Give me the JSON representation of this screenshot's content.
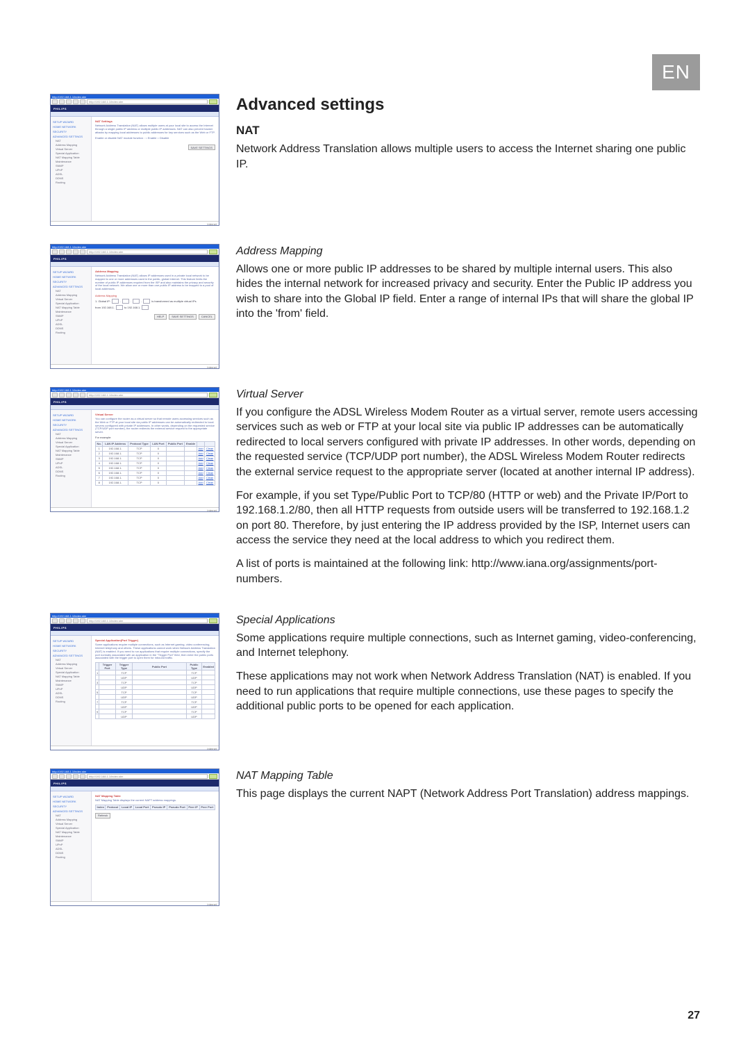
{
  "lang_badge": "EN",
  "page_number": "27",
  "heading_main": "Advanced settings",
  "mini_common": {
    "brand": "PHILIPS",
    "url": "http://192.168.1.1/index.stm",
    "footer": "Internet",
    "side_groups": [
      "SETUP WIZARD",
      "HOME NETWORK",
      "SECURITY",
      "ADVANCED SETTINGS"
    ],
    "side_items": [
      "NAT",
      "Address Mapping",
      "Virtual Server",
      "Special Application",
      "NAT Mapping Table",
      "Maintenance",
      "SNMP",
      "UPnP",
      "ADSL",
      "DDNS",
      "Routing"
    ]
  },
  "s1": {
    "h2": "NAT",
    "body": "Network Address Translation allows multiple users to access the Internet sharing one public IP.",
    "mini": {
      "title": "NAT Settings",
      "desc": "Network Address Translation (NAT) allows multiple users at your local site to access the Internet through a single public IP address or multiple public IP addresses. NAT can also prevent hacker attacks by mapping local addresses to public addresses for key services such as the Web or FTP.",
      "toggle": "Enable or disable NAT module function :   ○ Enable   ○ Disable",
      "btn_save": "SAVE SETTINGS"
    }
  },
  "s2": {
    "h3": "Address Mapping",
    "body": "Allows one or more public IP addresses to be shared by multiple internal users. This also hides the internal network for increased privacy and security. Enter the Public IP address you wish to share into the Global IP field. Enter a range of internal IPs that will share the global IP into the 'from' field.",
    "mini": {
      "title": "Address Mapping",
      "desc": "Network Address Translation (NAT) allows IP addresses used in a private local network to be mapped to one or more addresses used in the public, global Internet. This feature limits the number of public IP addresses required from the ISP and also maintains the privacy and security of the local network. We allow one or more than one public IP address to be mapped to a pool of local addresses.",
      "sect": "Address Mapping",
      "row1_pre": "1. Global IP:",
      "row1_post": "is transformed as multiple virtual IPs",
      "row2_pre": "from 192.168.1.",
      "row2_mid": "to 192.168.1.",
      "btn_help": "HELP",
      "btn_save": "SAVE SETTINGS",
      "btn_cancel": "CANCEL"
    }
  },
  "s3": {
    "h3": "Virtual Server",
    "p1": "If you configure the ADSL Wireless Modem Router as a virtual server, remote users accessing services such as web or FTP at your local site via public IP addresses can be automatically redirected to local servers configured with private IP addresses. In other words, depending on the requested service (TCP/UDP port number), the ADSL Wireless Modem Router redirects the external service request to the appropriate server (located at another internal IP address).",
    "p2": "For example, if you set Type/Public Port to TCP/80 (HTTP or web) and the Private IP/Port to 192.168.1.2/80, then all HTTP requests from outside users will be transferred to 192.168.1.2 on port 80. Therefore, by just entering the IP address provided by the ISP, Internet users can access the service they need at the local address to which you redirect them.",
    "p3": "A list of ports is maintained at the following link: http://www.iana.org/assignments/port-numbers.",
    "mini": {
      "title": "Virtual Server",
      "desc": "You can configure the router as a virtual server so that remote users accessing services such as the Web or FTP at your local site via public IP addresses can be automatically redirected to local servers configured with private IP addresses. In other words, depending on the requested service (TCP/UDP port number), the router redirects the external service request to the appropriate server.",
      "example_lbl": "For example:",
      "headers": [
        "No.",
        "LAN IP Address",
        "Protocol Type",
        "LAN Port",
        "Public Port",
        "Enable",
        "",
        ""
      ],
      "rows": [
        [
          "1",
          "192.168.1.",
          "TCP",
          "0",
          "",
          "",
          "Add",
          "Clean"
        ],
        [
          "2",
          "192.168.1.",
          "TCP",
          "0",
          "",
          "",
          "Add",
          "Clean"
        ],
        [
          "3",
          "192.168.1.",
          "TCP",
          "0",
          "",
          "",
          "Add",
          "Clean"
        ],
        [
          "4",
          "192.168.1.",
          "TCP",
          "0",
          "",
          "",
          "Add",
          "Clean"
        ],
        [
          "5",
          "192.168.1.",
          "TCP",
          "0",
          "",
          "",
          "Add",
          "Clean"
        ],
        [
          "6",
          "192.168.1.",
          "TCP",
          "0",
          "",
          "",
          "Add",
          "Clean"
        ],
        [
          "7",
          "192.168.1.",
          "TCP",
          "0",
          "",
          "",
          "Add",
          "Clean"
        ],
        [
          "8",
          "192.168.1.",
          "TCP",
          "0",
          "",
          "",
          "Add",
          "Clean"
        ]
      ]
    }
  },
  "s4": {
    "h3": "Special Applications",
    "p1": "Some applications require multiple connections, such as Internet gaming, video-conferencing, and Internet telephony.",
    "p2": "These applications may not work when Network Address Translation (NAT) is enabled. If you need to run applications that require multiple connections, use these pages to specify the additional public ports to be opened for each application.",
    "mini": {
      "title": "Special Application(Port Trigger)",
      "desc": "Some applications require multiple connections, such as Internet gaming, video conferencing, Internet telephony and others. These applications cannot work when Network Address Translation (NAT) is enabled. If you need to run applications that require multiple connections, specify the port normally associated with an application in the \"Trigger Port\" field, then enter the public ports associated with the trigger port to open them for inbound traffic.",
      "headers": [
        "",
        "Trigger Port",
        "Trigger Type",
        "Public Port",
        "Public Type",
        "Enabled"
      ],
      "rows": [
        [
          "1",
          "",
          "TCP",
          "",
          "TCP",
          ""
        ],
        [
          "2",
          "",
          "UDP",
          "",
          "UDP",
          ""
        ],
        [
          "3",
          "",
          "TCP",
          "",
          "TCP",
          ""
        ],
        [
          "4",
          "",
          "UDP",
          "",
          "UDP",
          ""
        ],
        [
          "5",
          "",
          "TCP",
          "",
          "TCP",
          ""
        ],
        [
          "6",
          "",
          "UDP",
          "",
          "UDP",
          ""
        ],
        [
          "7",
          "",
          "TCP",
          "",
          "TCP",
          ""
        ],
        [
          "8",
          "",
          "UDP",
          "",
          "UDP",
          ""
        ],
        [
          "9",
          "",
          "TCP",
          "",
          "TCP",
          ""
        ],
        [
          "10",
          "",
          "UDP",
          "",
          "UDP",
          ""
        ]
      ]
    }
  },
  "s5": {
    "h3": "NAT Mapping Table",
    "body": "This page displays the current NAPT (Network Address Port Translation) address mappings.",
    "mini": {
      "title": "NAT Mapping Table",
      "desc": "NAT Mapping Table displays the current NAPT address mappings.",
      "headers": [
        "Index",
        "Protocol",
        "Local IP",
        "Local Port",
        "Pseudo IP",
        "Pseudo Port",
        "Peer IP",
        "Peer Port"
      ],
      "btn_refresh": "Refresh"
    }
  }
}
